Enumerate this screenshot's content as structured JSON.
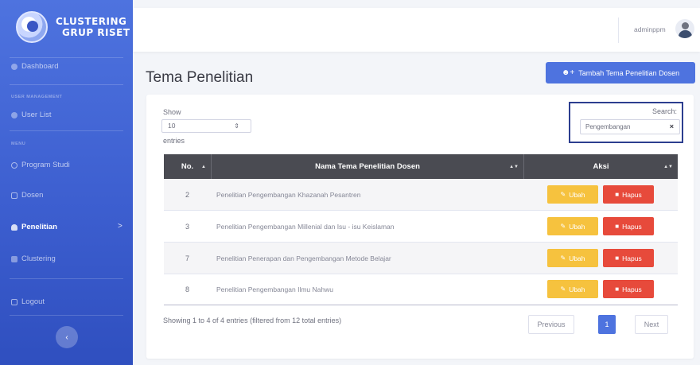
{
  "brand": {
    "line1": "CLUSTERING",
    "line2": "GRUP RISET"
  },
  "sidebar": {
    "dashboard": "Dashboard",
    "heading_user": "USER MANAGEMENT",
    "user_list": "User List",
    "heading_menu": "MENU",
    "program_studi": "Program Studi",
    "dosen": "Dosen",
    "penelitian": "Penelitian",
    "penelitian_arrow": ">",
    "clustering": "Clustering",
    "logout": "Logout",
    "toggle": "‹"
  },
  "topbar": {
    "username": "adminppm"
  },
  "page": {
    "title": "Tema Penelitian",
    "add_button": "Tambah Tema Penelitian Dosen"
  },
  "table_controls": {
    "show_label": "Show",
    "page_size": "10",
    "entries_label": "entries",
    "search_label": "Search:",
    "search_value": "Pengembangan",
    "clear": "×"
  },
  "table": {
    "headers": [
      "No.",
      "Nama Tema Penelitian Dosen",
      "Aksi"
    ],
    "rows": [
      {
        "no": "2",
        "name": "Penelitian Pengembangan Khazanah Pesantren",
        "edit": "Ubah",
        "delete": "Hapus"
      },
      {
        "no": "3",
        "name": "Penelitian Pengembangan Millenial dan Isu - isu Keislaman",
        "edit": "Ubah",
        "delete": "Hapus"
      },
      {
        "no": "7",
        "name": "Penelitian Penerapan dan Pengembangan Metode Belajar",
        "edit": "Ubah",
        "delete": "Hapus"
      },
      {
        "no": "8",
        "name": "Penelitian Pengembangan Ilmu Nahwu",
        "edit": "Ubah",
        "delete": "Hapus"
      }
    ]
  },
  "footer": {
    "info": "Showing 1 to 4 of 4 entries (filtered from 12 total entries)",
    "previous": "Previous",
    "current_page": "1",
    "next": "Next"
  },
  "colors": {
    "primary": "#4e73df",
    "warning": "#f6c23e",
    "danger": "#e74a3b",
    "table_header": "#4a4b52"
  }
}
